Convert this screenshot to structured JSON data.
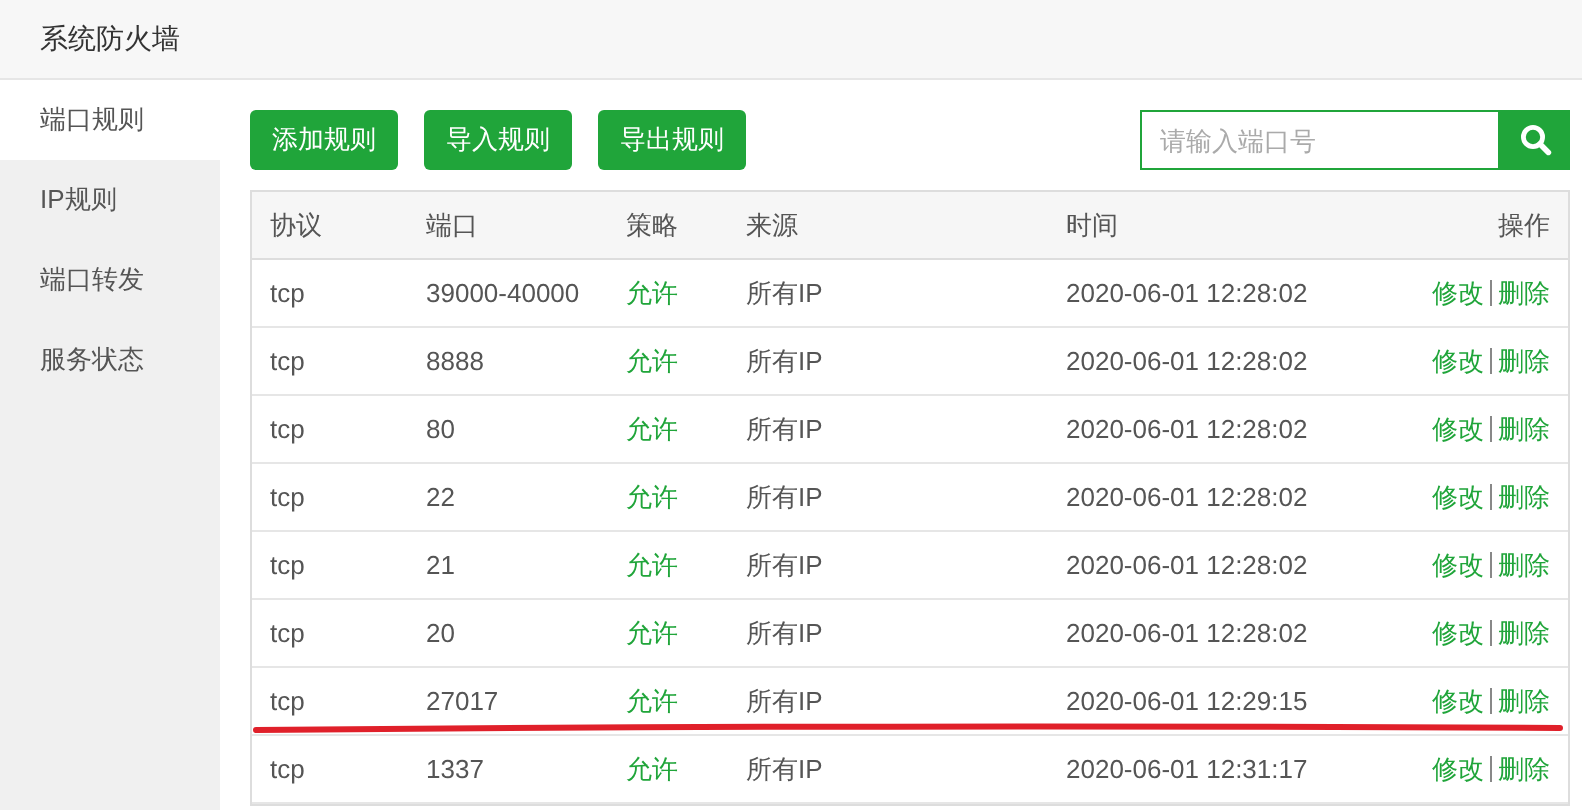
{
  "window": {
    "title": "系统防火墙"
  },
  "sidebar": {
    "items": [
      {
        "label": "端口规则",
        "selected": true
      },
      {
        "label": "IP规则",
        "selected": false
      },
      {
        "label": "端口转发",
        "selected": false
      },
      {
        "label": "服务状态",
        "selected": false
      }
    ]
  },
  "toolbar": {
    "buttons": [
      "添加规则",
      "导入规则",
      "导出规则"
    ],
    "search": {
      "placeholder": "请输入端口号"
    }
  },
  "table": {
    "columns": [
      "协议",
      "端口",
      "策略",
      "来源",
      "时间",
      "操作"
    ],
    "rows": [
      {
        "protocol": "tcp",
        "port": "39000-40000",
        "policy": "允许",
        "source": "所有IP",
        "time": "2020-06-01 12:28:02",
        "actions": [
          "修改",
          "删除"
        ],
        "underlined": false
      },
      {
        "protocol": "tcp",
        "port": "8888",
        "policy": "允许",
        "source": "所有IP",
        "time": "2020-06-01 12:28:02",
        "actions": [
          "修改",
          "删除"
        ],
        "underlined": false
      },
      {
        "protocol": "tcp",
        "port": "80",
        "policy": "允许",
        "source": "所有IP",
        "time": "2020-06-01 12:28:02",
        "actions": [
          "修改",
          "删除"
        ],
        "underlined": false
      },
      {
        "protocol": "tcp",
        "port": "22",
        "policy": "允许",
        "source": "所有IP",
        "time": "2020-06-01 12:28:02",
        "actions": [
          "修改",
          "删除"
        ],
        "underlined": false
      },
      {
        "protocol": "tcp",
        "port": "21",
        "policy": "允许",
        "source": "所有IP",
        "time": "2020-06-01 12:28:02",
        "actions": [
          "修改",
          "删除"
        ],
        "underlined": false
      },
      {
        "protocol": "tcp",
        "port": "20",
        "policy": "允许",
        "source": "所有IP",
        "time": "2020-06-01 12:28:02",
        "actions": [
          "修改",
          "删除"
        ],
        "underlined": false
      },
      {
        "protocol": "tcp",
        "port": "27017",
        "policy": "允许",
        "source": "所有IP",
        "time": "2020-06-01 12:29:15",
        "actions": [
          "修改",
          "删除"
        ],
        "underlined": true
      },
      {
        "protocol": "tcp",
        "port": "1337",
        "policy": "允许",
        "source": "所有IP",
        "time": "2020-06-01 12:31:17",
        "actions": [
          "修改",
          "删除"
        ],
        "underlined": false
      }
    ]
  }
}
